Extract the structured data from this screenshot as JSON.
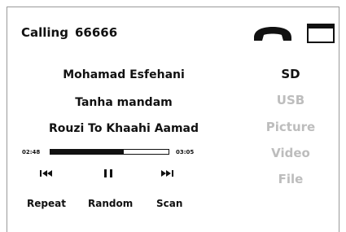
{
  "call": {
    "status": "Calling",
    "number": "66666"
  },
  "track": {
    "artist": "Mohamad Esfehani",
    "title": "Tanha mandam",
    "album": "Rouzi To Khaahi Aamad",
    "time_current": "02:48",
    "time_total": "03:05",
    "progress": 0.62
  },
  "options": {
    "repeat": "Repeat",
    "random": "Random",
    "scan": "Scan"
  },
  "sources": [
    {
      "label": "SD",
      "active": true
    },
    {
      "label": "USB",
      "active": false
    },
    {
      "label": "Picture",
      "active": false
    },
    {
      "label": "Video",
      "active": false
    },
    {
      "label": "File",
      "active": false
    }
  ],
  "icons": {
    "phone": "phone-hangup-icon",
    "screen": "window-icon",
    "prev": "previous-track-icon",
    "pause": "pause-icon",
    "next": "next-track-icon"
  },
  "colors": {
    "active": "#111111",
    "inactive": "#bdbdbd"
  }
}
